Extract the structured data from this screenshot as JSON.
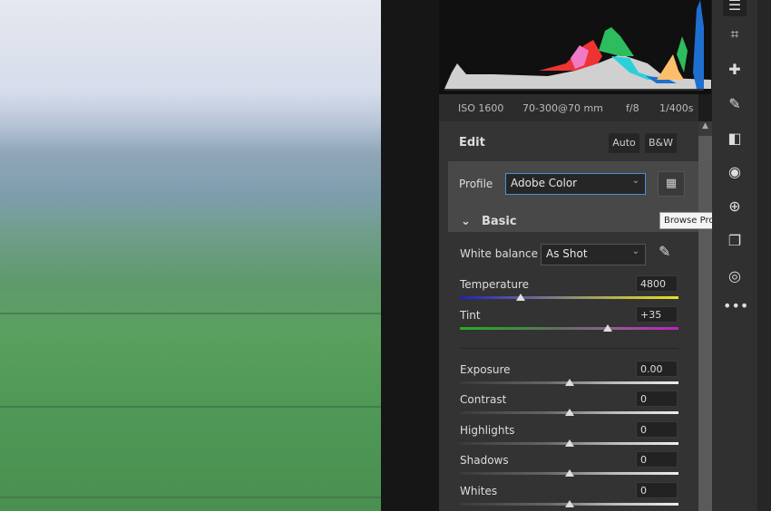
{
  "camera_info": {
    "iso": "ISO 1600",
    "lens": "70-300@70 mm",
    "aperture": "f/8",
    "shutter": "1/400s"
  },
  "edit": {
    "title": "Edit",
    "auto": "Auto",
    "bw": "B&W"
  },
  "profile": {
    "label": "Profile",
    "value": "Adobe Color",
    "browse_tooltip": "Browse Profiles"
  },
  "basic": {
    "title": "Basic"
  },
  "white_balance": {
    "label": "White balance",
    "value": "As Shot"
  },
  "sliders": [
    {
      "label": "Temperature",
      "value": "4800",
      "position": 0.28
    },
    {
      "label": "Tint",
      "value": "+35",
      "position": 0.675
    },
    {
      "label": "Exposure",
      "value": "0.00",
      "position": 0.5
    },
    {
      "label": "Contrast",
      "value": "0",
      "position": 0.5
    },
    {
      "label": "Highlights",
      "value": "0",
      "position": 0.5
    },
    {
      "label": "Shadows",
      "value": "0",
      "position": 0.5
    },
    {
      "label": "Whites",
      "value": "0",
      "position": 0.5
    }
  ],
  "colors": {
    "accent": "#4a8fd8",
    "panel": "#333333"
  }
}
